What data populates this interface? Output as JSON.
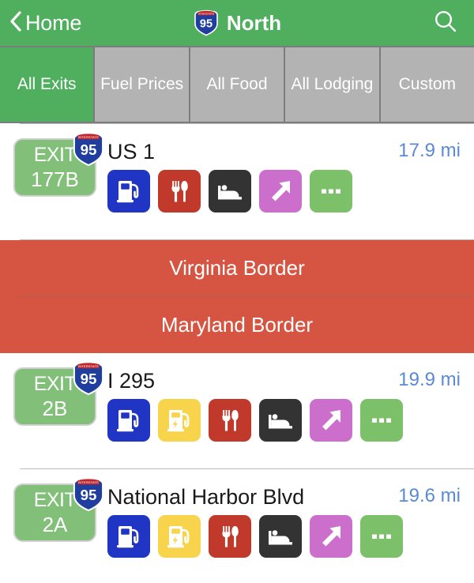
{
  "header": {
    "back_label": "Home",
    "back_icon": "chevron-left-icon",
    "title": "North",
    "shield_route": "95",
    "shield_banner": "INTERSTATE",
    "search_icon": "search-icon",
    "background_color": "#4FAF5F"
  },
  "tabs": [
    {
      "label": "All Exits",
      "active": true
    },
    {
      "label": "Fuel Prices",
      "active": false
    },
    {
      "label": "All Food",
      "active": false
    },
    {
      "label": "All Lodging",
      "active": false
    },
    {
      "label": "Custom",
      "active": false
    }
  ],
  "colors": {
    "accent_green": "#4FAF5F",
    "badge_green": "#82C07A",
    "distance_blue": "#5a8ad6",
    "border_red": "#d65542",
    "tab_inactive": "#b3b3b3"
  },
  "exits": [
    {
      "exit_word": "EXIT",
      "exit_number": "177B",
      "shield_route": "95",
      "name": "US 1",
      "distance": "17.9 mi",
      "amenities": [
        "gas",
        "food",
        "lodging",
        "exitramp",
        "more"
      ]
    },
    {
      "exit_word": "EXIT",
      "exit_number": "2B",
      "shield_route": "95",
      "name": "I 295",
      "distance": "19.9 mi",
      "amenities": [
        "gas",
        "ev",
        "food",
        "lodging",
        "exitramp",
        "more"
      ]
    },
    {
      "exit_word": "EXIT",
      "exit_number": "2A",
      "shield_route": "95",
      "name": "National Harbor Blvd",
      "distance": "19.6 mi",
      "amenities": [
        "gas",
        "ev",
        "food",
        "lodging",
        "exitramp",
        "more"
      ]
    }
  ],
  "borders": [
    {
      "label": "Virginia Border"
    },
    {
      "label": "Maryland Border"
    }
  ],
  "amenity_icon_names": {
    "gas": "gas-pump-icon",
    "ev": "ev-charging-icon",
    "food": "restaurant-icon",
    "lodging": "lodging-bed-icon",
    "exitramp": "exit-arrow-icon",
    "more": "more-options-icon"
  }
}
